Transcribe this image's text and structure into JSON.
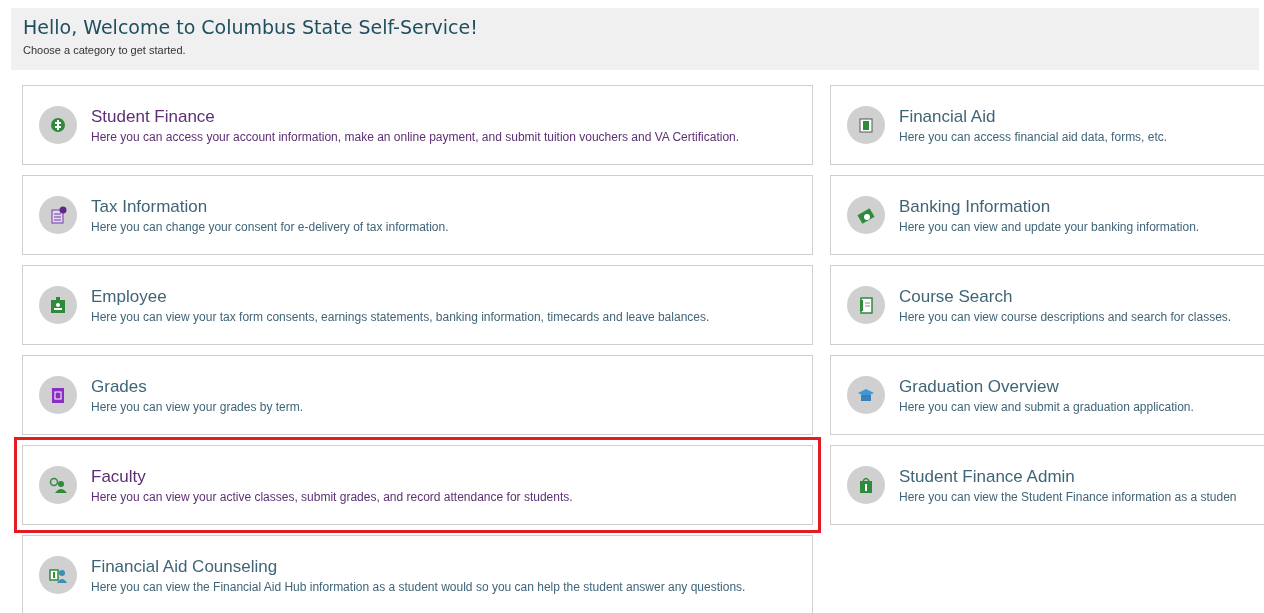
{
  "header": {
    "title": "Hello, Welcome to Columbus State Self-Service!",
    "subtitle": "Choose a category to get started."
  },
  "left_column": [
    {
      "title": "Student Finance",
      "description": "Here you can access your account information, make an online payment, and submit tuition vouchers and VA Certification.",
      "visited": true,
      "highlighted": false
    },
    {
      "title": "Tax Information",
      "description": "Here you can change your consent for e-delivery of tax information.",
      "visited": false,
      "highlighted": false
    },
    {
      "title": "Employee",
      "description": "Here you can view your tax form consents, earnings statements, banking information, timecards and leave balances.",
      "visited": false,
      "highlighted": false
    },
    {
      "title": "Grades",
      "description": "Here you can view your grades by term.",
      "visited": false,
      "highlighted": false
    },
    {
      "title": "Faculty",
      "description": "Here you can view your active classes, submit grades, and record attendance for students.",
      "visited": true,
      "highlighted": true
    },
    {
      "title": "Financial Aid Counseling",
      "description": "Here you can view the Financial Aid Hub information as a student would so you can help the student answer any questions.",
      "visited": false,
      "highlighted": false
    }
  ],
  "right_column": [
    {
      "title": "Financial Aid",
      "description": "Here you can access financial aid data, forms, etc.",
      "visited": false,
      "highlighted": false
    },
    {
      "title": "Banking Information",
      "description": "Here you can view and update your banking information.",
      "visited": false,
      "highlighted": false
    },
    {
      "title": "Course Search",
      "description": "Here you can view course descriptions and search for classes.",
      "visited": false,
      "highlighted": false
    },
    {
      "title": "Graduation Overview",
      "description": "Here you can view and submit a graduation application.",
      "visited": false,
      "highlighted": false
    },
    {
      "title": "Student Finance Admin",
      "description": "Here you can view the Student Finance information as a studen",
      "visited": false,
      "highlighted": false
    }
  ]
}
